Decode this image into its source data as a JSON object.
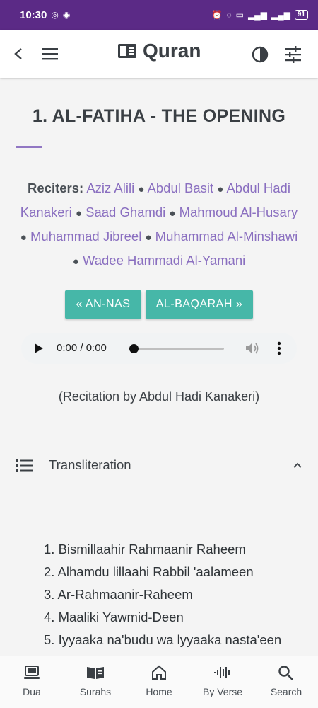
{
  "status_bar": {
    "time": "10:30",
    "battery": "91"
  },
  "app_bar": {
    "title": "Quran"
  },
  "surah": {
    "title": "1. AL-FATIHA - THE OPENING",
    "reciters_label": "Reciters:",
    "reciters": [
      "Aziz Alili",
      "Abdul Basit",
      "Abdul Hadi Kanakeri",
      "Saad Ghamdi",
      "Mahmoud Al-Husary",
      "Muhammad Jibreel",
      "Muhammad Al-Minshawi",
      "Wadee Hammadi Al-Yamani"
    ],
    "prev_label": "« AN-NAS",
    "next_label": "AL-BAQARAH »",
    "recitation_note": "(Recitation by Abdul Hadi Kanakeri)"
  },
  "audio": {
    "time": "0:00 / 0:00",
    "progress": 0
  },
  "transliteration": {
    "label": "Transliteration",
    "verses": [
      "1. Bismillaahir Rahmaanir Raheem",
      "2. Alhamdu lillaahi Rabbil 'aalameen",
      "3. Ar-Rahmaanir-Raheem",
      "4. Maaliki Yawmid-Deen",
      "5. Iyyaaka na'budu wa lyyaaka nasta'een"
    ]
  },
  "bottom_nav": {
    "items": [
      {
        "label": "Dua",
        "icon": "laptop-icon"
      },
      {
        "label": "Surahs",
        "icon": "book-open-icon"
      },
      {
        "label": "Home",
        "icon": "home-icon"
      },
      {
        "label": "By Verse",
        "icon": "waveform-icon"
      },
      {
        "label": "Search",
        "icon": "search-icon"
      }
    ]
  },
  "colors": {
    "status_bar": "#5b2a86",
    "accent_link": "#8a6fc0",
    "button": "#46b7a8"
  }
}
